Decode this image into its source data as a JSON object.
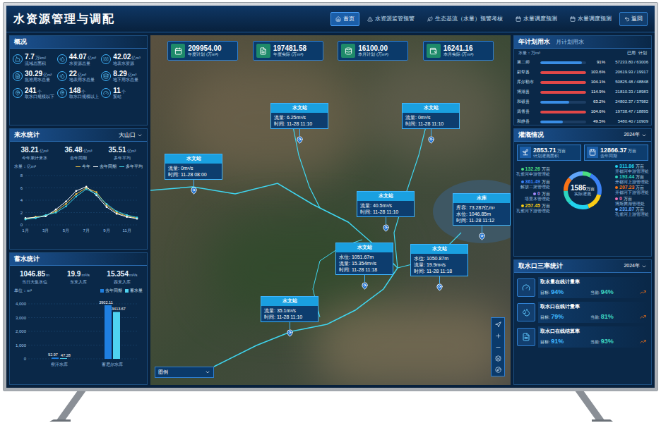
{
  "header": {
    "title": "水资源管理与调配",
    "nav": [
      {
        "label": "首页",
        "selected": true
      },
      {
        "label": "水资源监管预警",
        "selected": false
      },
      {
        "label": "生态基流（水量）预警考核",
        "selected": false
      },
      {
        "label": "水量调度预测",
        "selected": false
      },
      {
        "label": "水量调度预测",
        "selected": false
      }
    ],
    "back": "返回"
  },
  "overview": {
    "title": "概况",
    "items": [
      {
        "value": "7.7",
        "unit": "万km²",
        "label": "流域总面积"
      },
      {
        "value": "44.07",
        "unit": "亿m³",
        "label": "水资源总量"
      },
      {
        "value": "42.02",
        "unit": "亿m³",
        "label": "地表水资源"
      },
      {
        "value": "30.29",
        "unit": "亿m³",
        "label": "批准用水总量"
      },
      {
        "value": "22",
        "unit": "亿m³",
        "label": "地表用水总量"
      },
      {
        "value": "8.29",
        "unit": "亿m³",
        "label": "地下用水总量"
      },
      {
        "value": "241",
        "unit": "个",
        "label": "取水口规模以下"
      },
      {
        "value": "148",
        "unit": "个",
        "label": "取水口规模以上"
      },
      {
        "value": "11",
        "unit": "个",
        "label": "泵站"
      }
    ]
  },
  "inflow": {
    "title": "来水统计",
    "station": "大山口",
    "stats": [
      {
        "value": "38.21",
        "unit": "亿m³",
        "label": "今年累计来水"
      },
      {
        "value": "36.48",
        "unit": "亿m³",
        "label": "去年同期"
      },
      {
        "value": "35.51",
        "unit": "亿m³",
        "label": "多年平均"
      }
    ],
    "chart": {
      "unit": "水量：亿m³",
      "axis_max": 8,
      "y_ticks": [
        "8",
        "6",
        "4",
        "2",
        "0"
      ],
      "x_ticks": [
        "1月",
        "3月",
        "5月",
        "7月",
        "9月",
        "11月"
      ],
      "series": [
        {
          "name": "今年",
          "color": "#f5c542",
          "values": [
            1.0,
            1.3,
            1.5,
            2.2,
            3.4,
            5.0,
            6.0,
            5.3,
            3.2,
            2.0,
            1.4,
            1.1
          ]
        },
        {
          "name": "去年同期",
          "color": "#ffffff",
          "values": [
            1.1,
            1.2,
            1.4,
            2.5,
            3.8,
            5.5,
            6.2,
            4.8,
            2.9,
            1.8,
            1.3,
            1.0
          ]
        },
        {
          "name": "多年平均",
          "color": "#3fd6e8",
          "values": [
            0.9,
            1.1,
            1.6,
            2.0,
            3.0,
            4.6,
            5.8,
            5.0,
            3.4,
            2.2,
            1.6,
            1.2
          ]
        }
      ]
    }
  },
  "storage": {
    "title": "蓄水统计",
    "stats": [
      {
        "value": "1046.85",
        "unit": "m",
        "label": "当日大集水位"
      },
      {
        "value": "19.9",
        "unit": "m³/s",
        "label": "东支入库"
      },
      {
        "value": "15.354",
        "unit": "m³/s",
        "label": "西支入库"
      }
    ],
    "chart": {
      "unit": "单位：m³",
      "axis_max": 4000,
      "legend": [
        {
          "name": "去年同期",
          "color": "#1f7fe0"
        },
        {
          "name": "蓄水量",
          "color": "#4fd3f0"
        }
      ],
      "y_ticks": [
        "4,000",
        "3,000",
        "2,000",
        "1,000",
        "0"
      ],
      "groups": [
        {
          "label": "察汗水库",
          "values": [
            92.97,
            47.28
          ],
          "value_labels": [
            "92.97",
            "47.28"
          ]
        },
        {
          "label": "蓄尼尔水库",
          "values": [
            3902.11,
            3413.67
          ],
          "value_labels": [
            "3902.11",
            "3413.67"
          ]
        }
      ]
    }
  },
  "totals": [
    {
      "value": "209954.00",
      "label": "年度计划 (万m³)"
    },
    {
      "value": "197481.58",
      "label": "年度实际 (万m³)"
    },
    {
      "value": "16100.00",
      "label": "本月计划 (万m³)"
    },
    {
      "value": "16241.16",
      "label": "本月实际 (万m³)"
    }
  ],
  "map": {
    "legend": "图例",
    "stations": [
      {
        "title": "水文站",
        "lines": [
          "流量: 6.25m³/s",
          "时间: 11-28 11:10"
        ]
      },
      {
        "title": "水文站",
        "lines": [
          "流量: 0m³/s",
          "时间: 11-28 11:10"
        ]
      },
      {
        "title": "水文站",
        "lines": [
          "流量: 0m³/s",
          "时间: 11-28 08:00"
        ]
      },
      {
        "title": "水文站",
        "lines": [
          "流量: 40.5m³/s",
          "时间: 11-28 11:10"
        ]
      },
      {
        "title": "水库",
        "lines": [
          "库容: 73.287亿m³",
          "水位: 1046.85m",
          "时间: 11-28 11:12"
        ]
      },
      {
        "title": "水文站",
        "lines": [
          "水位: 1051.67m",
          "流量: 15.354m³/s",
          "时间: 11-28 11:18"
        ]
      },
      {
        "title": "水文站",
        "lines": [
          "水位: 1050.87m",
          "流量: 19.9m³/s",
          "时间: 11-28 11:18"
        ]
      },
      {
        "title": "水文站",
        "lines": [
          "流量: 35.1m³/s",
          "时间: 11-28 11:10"
        ]
      }
    ]
  },
  "water_plan": {
    "tabs": [
      {
        "label": "年计划用水",
        "selected": true
      },
      {
        "label": "月计划用水",
        "selected": false
      }
    ],
    "unit": "水量：万m³",
    "legend": [
      "已用",
      "计划"
    ],
    "rows": [
      {
        "name": "第二师",
        "pct": "91%",
        "reading": "57233.80 / 63006",
        "level": 0.91,
        "color": "#3a8ee6"
      },
      {
        "name": "尉犁县",
        "pct": "103.6%",
        "reading": "20619.93 / 19917",
        "level": 1,
        "color": "#e04848"
      },
      {
        "name": "库尔勒市",
        "pct": "104.1%",
        "reading": "50825.48 / 48848",
        "level": 1,
        "color": "#e04848"
      },
      {
        "name": "博湖县",
        "pct": "114.9%",
        "reading": "21810.33 / 18983",
        "level": 1,
        "color": "#e04848"
      },
      {
        "name": "和硕县",
        "pct": "63.2%",
        "reading": "24802.37 / 37982",
        "level": 0.632,
        "color": "#3a8ee6"
      },
      {
        "name": "焉耆县",
        "pct": "104.6%",
        "reading": "19738.47 / 18895",
        "level": 1,
        "color": "#e04848"
      },
      {
        "name": "和静县",
        "pct": "49.5%",
        "reading": "5480.40 / 10909",
        "level": 0.495,
        "color": "#3a8ee6"
      }
    ]
  },
  "irrigation": {
    "title": "灌溉情况",
    "year": "2024年",
    "cards": [
      {
        "value": "2853.71",
        "unit": "万亩",
        "label": "计划灌溉面积"
      },
      {
        "value": "12866.37",
        "unit": "万亩",
        "label": "去年同期"
      }
    ],
    "total": {
      "value": "1586",
      "unit": "万亩",
      "label": "实际灌溉"
    },
    "left_items": [
      {
        "value": "132.26",
        "unit": "万亩",
        "label": "孔雀河中游管理处",
        "amount": 132.26,
        "color": "#4ade80"
      },
      {
        "value": "361.49",
        "unit": "万亩",
        "label": "解放二渠管理处",
        "amount": 361.49,
        "color": "#3b82f6"
      },
      {
        "value": "0",
        "unit": "万亩",
        "label": "塔里木管理处",
        "amount": 0,
        "color": "#a78bfa"
      },
      {
        "value": "257.45",
        "unit": "万亩",
        "label": "孔雀河下游管理处",
        "amount": 257.45,
        "color": "#facc15"
      }
    ],
    "right_items": [
      {
        "value": "311.86",
        "unit": "万亩",
        "label": "开都河中游管理处",
        "amount": 311.86,
        "color": "#22d3ee"
      },
      {
        "value": "193.44",
        "unit": "万亩",
        "label": "开都河上游管理处",
        "amount": 193.44,
        "color": "#2dd4bf"
      },
      {
        "value": "207.23",
        "unit": "万亩",
        "label": "开都河下游管理处",
        "amount": 207.23,
        "color": "#f97316"
      },
      {
        "value": "0",
        "unit": "万亩",
        "label": "博斯腾湖管理处",
        "amount": 0,
        "color": "#f472b6"
      },
      {
        "value": "231.87",
        "unit": "万亩",
        "label": "孔雀河上游管理处",
        "amount": 231.87,
        "color": "#60a5fa"
      }
    ]
  },
  "rates": {
    "title": "取水口三率统计",
    "year": "2024年",
    "rows": [
      {
        "name": "取水量在线计量率",
        "target_label": "目标:",
        "target": "94%",
        "current_label": "当前:",
        "current": "94%"
      },
      {
        "name": "取水口在线计量率",
        "target_label": "目标:",
        "target": "79%",
        "current_label": "当前:",
        "current": "81%"
      },
      {
        "name": "取水口在线结算率",
        "target_label": "目标:",
        "target": "91%",
        "current_label": "当前:",
        "current": "93%"
      }
    ]
  }
}
